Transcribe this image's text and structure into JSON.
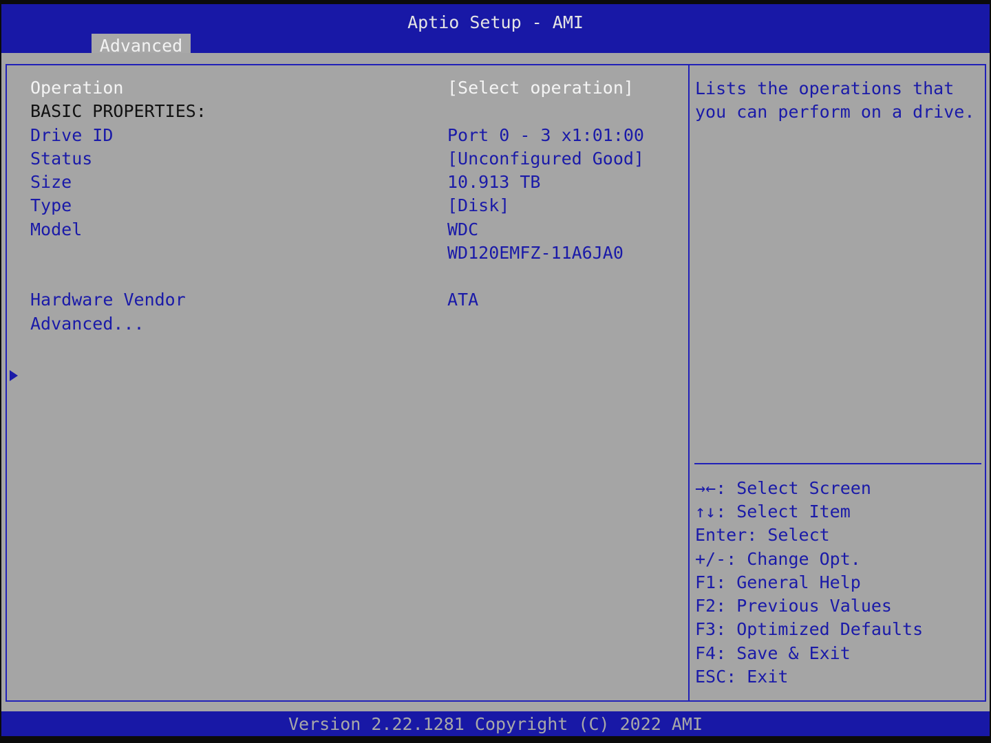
{
  "header": {
    "title": "Aptio Setup - AMI",
    "tab_label": "Advanced"
  },
  "settings": {
    "operation": {
      "label": "Operation",
      "value": "[Select operation]"
    },
    "section_heading": "BASIC PROPERTIES:",
    "drive_id": {
      "label": "Drive ID",
      "value": "Port 0 - 3 x1:01:00"
    },
    "status": {
      "label": "Status",
      "value": "[Unconfigured Good]"
    },
    "size": {
      "label": "Size",
      "value": "10.913 TB"
    },
    "type": {
      "label": "Type",
      "value": "[Disk]"
    },
    "model": {
      "label": "Model",
      "value_line1": "WDC",
      "value_line2": "WD120EMFZ-11A6JA0"
    },
    "hardware_vendor": {
      "label": "Hardware Vendor",
      "value": "ATA"
    },
    "advanced_submenu": {
      "label": "Advanced..."
    }
  },
  "help_panel": {
    "line1": "Lists the operations that",
    "line2": "you can perform on a drive."
  },
  "keys": [
    "→←: Select Screen",
    "↑↓: Select Item",
    "Enter: Select",
    "+/-: Change Opt.",
    "F1: General Help",
    "F2: Previous Values",
    "F3: Optimized Defaults",
    "F4: Save & Exit",
    "ESC: Exit"
  ],
  "footer": {
    "version": "Version 2.22.1281 Copyright (C) 2022 AMI"
  },
  "colors": {
    "header_bg": "#1818a6",
    "panel_bg": "#a5a5a5",
    "selected_text": "#f4f4f4",
    "item_text": "#1a1aa8"
  }
}
